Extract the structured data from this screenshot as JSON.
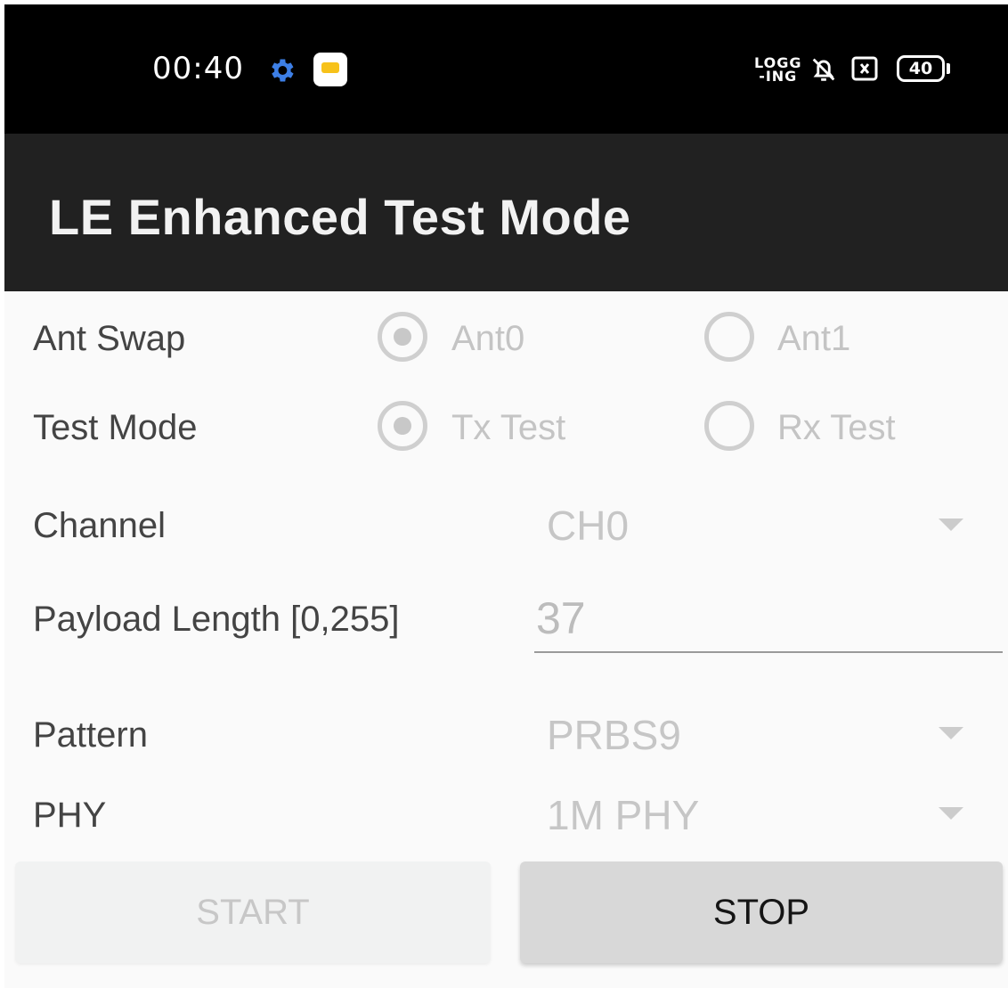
{
  "status_bar": {
    "time": "00:40",
    "icons": [
      "gear-icon",
      "message-icon",
      "logging-icon",
      "bell-off-icon",
      "close-box-icon",
      "battery-icon"
    ],
    "logging_text": "LOGG\n-ING",
    "battery": "40",
    "gear_color": "#3d7fe6",
    "message_color": "#f7c21a"
  },
  "app_bar": {
    "title": "LE Enhanced Test Mode"
  },
  "form": {
    "ant_swap": {
      "label": "Ant Swap",
      "options": [
        "Ant0",
        "Ant1"
      ],
      "selected": "Ant0"
    },
    "test_mode": {
      "label": "Test Mode",
      "options": [
        "Tx Test",
        "Rx Test"
      ],
      "selected": "Tx Test"
    },
    "channel": {
      "label": "Channel",
      "value": "CH0"
    },
    "payload_length": {
      "label": "Payload Length [0,255]",
      "value": "37"
    },
    "pattern": {
      "label": "Pattern",
      "value": "PRBS9"
    },
    "phy": {
      "label": "PHY",
      "value": "1M PHY"
    }
  },
  "buttons": {
    "start": "START",
    "stop": "STOP"
  }
}
